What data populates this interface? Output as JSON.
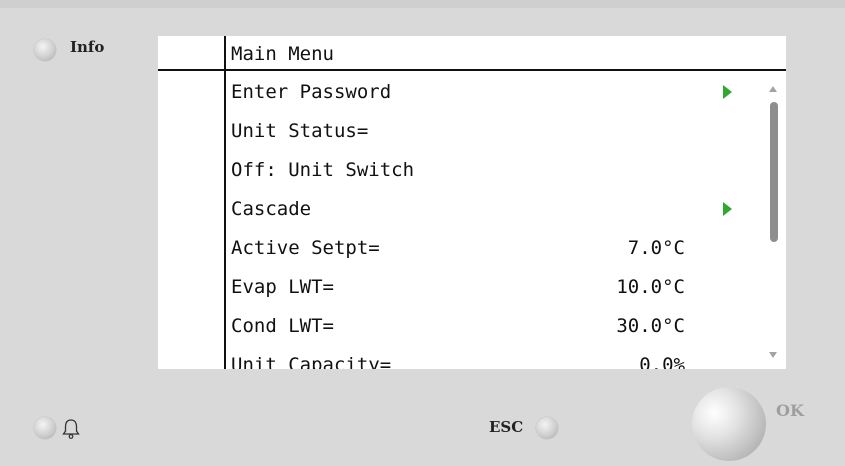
{
  "buttons": {
    "info_label": "Info",
    "esc_label": "ESC",
    "ok_label": "OK"
  },
  "menu": {
    "title": "Main Menu",
    "items": [
      {
        "label": "Enter Password",
        "value": "",
        "has_submenu": true
      },
      {
        "label": "Unit Status=",
        "value": "",
        "has_submenu": false
      },
      {
        "label": "Off: Unit Switch",
        "value": "",
        "has_submenu": false
      },
      {
        "label": "Cascade",
        "value": "",
        "has_submenu": true
      },
      {
        "label": "Active Setpt=",
        "value": "7.0°C",
        "has_submenu": false
      },
      {
        "label": "Evap LWT=",
        "value": "10.0°C",
        "has_submenu": false
      },
      {
        "label": "Cond LWT=",
        "value": "30.0°C",
        "has_submenu": false
      },
      {
        "label": "Unit Capacity=",
        "value": "0.0%",
        "has_submenu": false
      }
    ]
  },
  "icons": {
    "submenu": "triangle-right-icon",
    "alarm": "bell-icon"
  },
  "colors": {
    "panel": "#d9d9d9",
    "screen": "#ffffff",
    "submenu_arrow": "#2ea82e",
    "scrollbar": "#8e8e8e"
  }
}
